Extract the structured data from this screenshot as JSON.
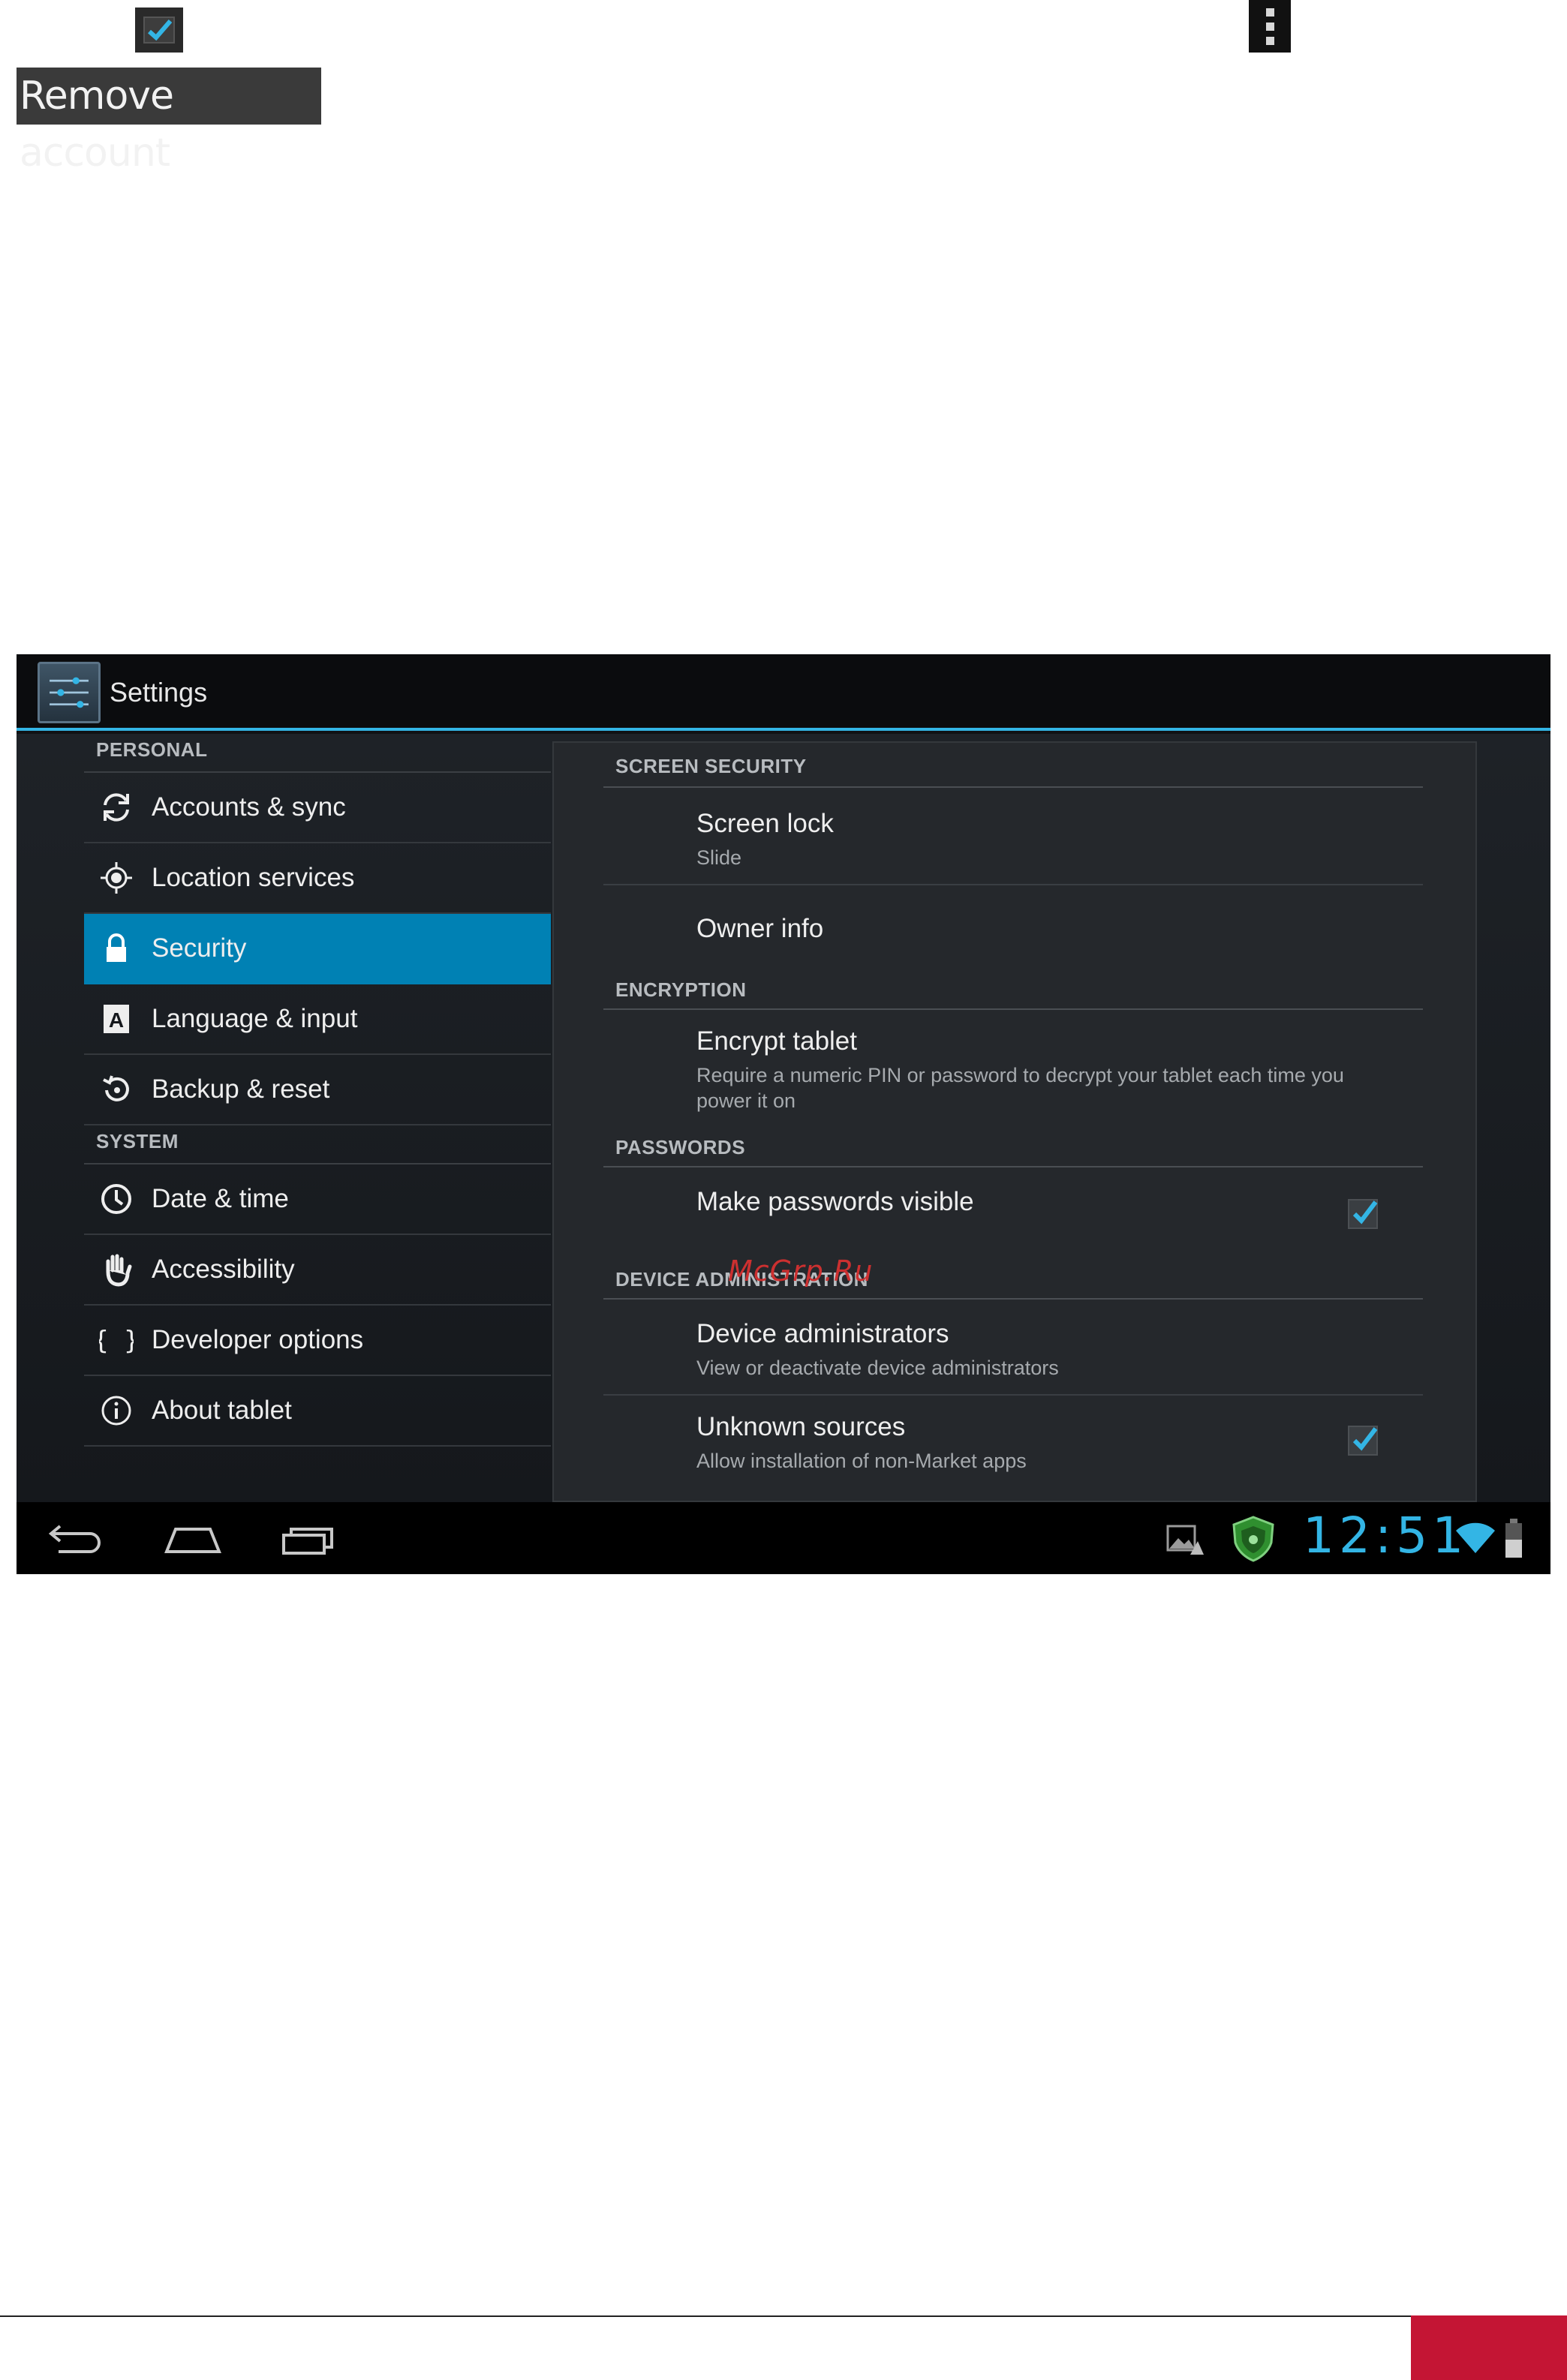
{
  "manual": {
    "remove_account_label": "Remove account"
  },
  "app": {
    "title": "Settings"
  },
  "sidebar": {
    "categories": [
      "PERSONAL",
      "SYSTEM"
    ],
    "items": [
      {
        "label": "Accounts & sync",
        "icon": "sync-icon"
      },
      {
        "label": "Location services",
        "icon": "location-icon"
      },
      {
        "label": "Security",
        "icon": "lock-icon",
        "selected": true
      },
      {
        "label": "Language & input",
        "icon": "keyboard-letter-icon"
      },
      {
        "label": "Backup & reset",
        "icon": "backup-icon"
      },
      {
        "label": "Date & time",
        "icon": "clock-icon"
      },
      {
        "label": "Accessibility",
        "icon": "hand-icon"
      },
      {
        "label": "Developer options",
        "icon": "braces-icon"
      },
      {
        "label": "About tablet",
        "icon": "info-icon"
      }
    ]
  },
  "security": {
    "sections": {
      "screen_security": "SCREEN SECURITY",
      "encryption": "ENCRYPTION",
      "passwords": "PASSWORDS",
      "device_administration": "DEVICE ADMINISTRATION"
    },
    "screen_lock": {
      "title": "Screen lock",
      "summary": "Slide"
    },
    "owner_info": {
      "title": "Owner info"
    },
    "encrypt_tablet": {
      "title": "Encrypt tablet",
      "summary": "Require a numeric PIN or password to decrypt your tablet each time you power it on"
    },
    "make_passwords_visible": {
      "title": "Make passwords visible",
      "checked": true
    },
    "device_administrators": {
      "title": "Device administrators",
      "summary": "View or deactivate device administrators"
    },
    "unknown_sources": {
      "title": "Unknown sources",
      "summary": "Allow installation of non-Market apps",
      "checked": true
    }
  },
  "watermark": "McGrp.Ru",
  "status_bar": {
    "time": "12:51"
  },
  "colors": {
    "accent": "#33b5e5",
    "selected_item": "#0081b4",
    "footer_accent": "#c41534"
  }
}
